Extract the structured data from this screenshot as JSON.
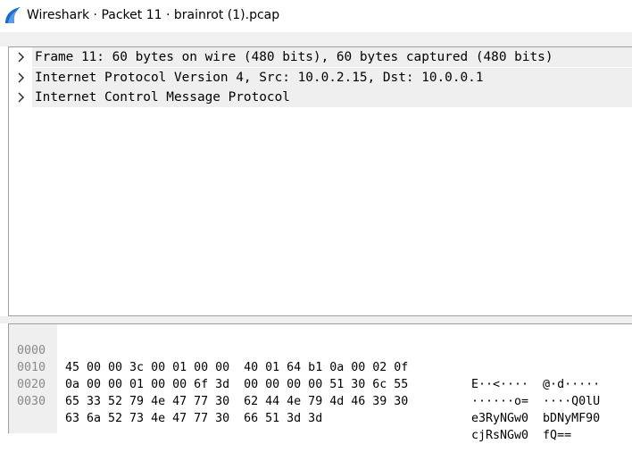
{
  "window": {
    "title": "Wireshark · Packet 11 · brainrot (1).pcap"
  },
  "details_tree": [
    {
      "label": "Frame 11: 60 bytes on wire (480 bits), 60 bytes captured (480 bits)"
    },
    {
      "label": "Internet Protocol Version 4, Src: 10.0.2.15, Dst: 10.0.0.1"
    },
    {
      "label": "Internet Control Message Protocol"
    }
  ],
  "hex_dump": [
    {
      "offset": "0000",
      "bytes": "45 00 00 3c 00 01 00 00  40 01 64 b1 0a 00 02 0f",
      "ascii": "E··<····  @·d·····"
    },
    {
      "offset": "0010",
      "bytes": "0a 00 00 01 00 00 6f 3d  00 00 00 00 51 30 6c 55",
      "ascii": "······o=  ····Q0lU"
    },
    {
      "offset": "0020",
      "bytes": "65 33 52 79 4e 47 77 30  62 44 4e 79 4d 46 39 30",
      "ascii": "e3RyNGw0  bDNyMF90"
    },
    {
      "offset": "0030",
      "bytes": "63 6a 52 73 4e 47 77 30  66 51 3d 3d",
      "ascii": "cjRsNGw0  fQ=="
    }
  ],
  "colors": {
    "app_icon": "#1b6ac9",
    "tree_row_bg": "#efefef",
    "offset_text": "#8a8a8a"
  }
}
